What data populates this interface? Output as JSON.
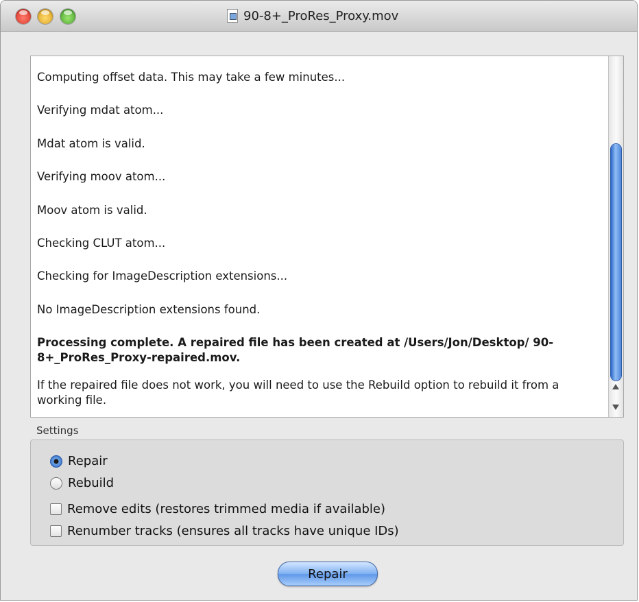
{
  "window": {
    "title": "90-8+_ProRes_Proxy.mov"
  },
  "log": {
    "lines": [
      "Computing offset data. This may take a few minutes...",
      "Verifying mdat atom...",
      "Mdat atom is valid.",
      "Verifying moov atom...",
      "Moov atom is valid.",
      "Checking CLUT atom...",
      "Checking for ImageDescription extensions...",
      "No ImageDescription extensions found.",
      "Processing complete. A repaired file has been created at /Users/Jon/Desktop/ 90-8+_ProRes_Proxy-repaired.mov.",
      "If the repaired file does not work, you will need to use the Rebuild option to rebuild it from a working file."
    ]
  },
  "settings": {
    "label": "Settings",
    "mode_selected": "Repair",
    "options": {
      "repair": "Repair",
      "rebuild": "Rebuild"
    },
    "checkboxes": {
      "remove_edits": "Remove edits (restores trimmed media if available)",
      "remove_edits_checked": false,
      "renumber_tracks": "Renumber tracks (ensures all tracks have unique IDs)",
      "renumber_tracks_checked": false
    }
  },
  "button": {
    "repair_label": "Repair"
  },
  "colors": {
    "accent": "#3b78d8",
    "window_bg": "#e9e9e9"
  }
}
